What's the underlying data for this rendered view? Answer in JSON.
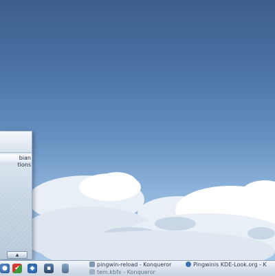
{
  "menu": {
    "items": [
      {
        "label": "bian",
        "selected": true
      },
      {
        "label": "tions",
        "selected": false
      }
    ],
    "scroll_icon": "up-arrow-icon"
  },
  "taskbar": {
    "launchers": [
      {
        "icon": "kmenu-icon"
      },
      {
        "icon": "kde-icon"
      },
      {
        "icon": "konqueror-icon"
      },
      {
        "icon": "terminal-icon"
      },
      {
        "icon": "desktop-icon"
      }
    ],
    "tasks": [
      {
        "label": "pingwin-reload - Konqueror",
        "icon": "folder-icon"
      },
      {
        "label": "Pingwinis KDE-Look.org - K",
        "icon": "globe-icon"
      },
      {
        "label": "tem.kbfx - Konqueror",
        "icon": "folder-icon"
      }
    ]
  },
  "colors": {
    "sky_top": "#3d5f8e",
    "sky_bottom": "#aecbe8",
    "cloud": "#ffffff",
    "panel": "#d9e2ec"
  }
}
